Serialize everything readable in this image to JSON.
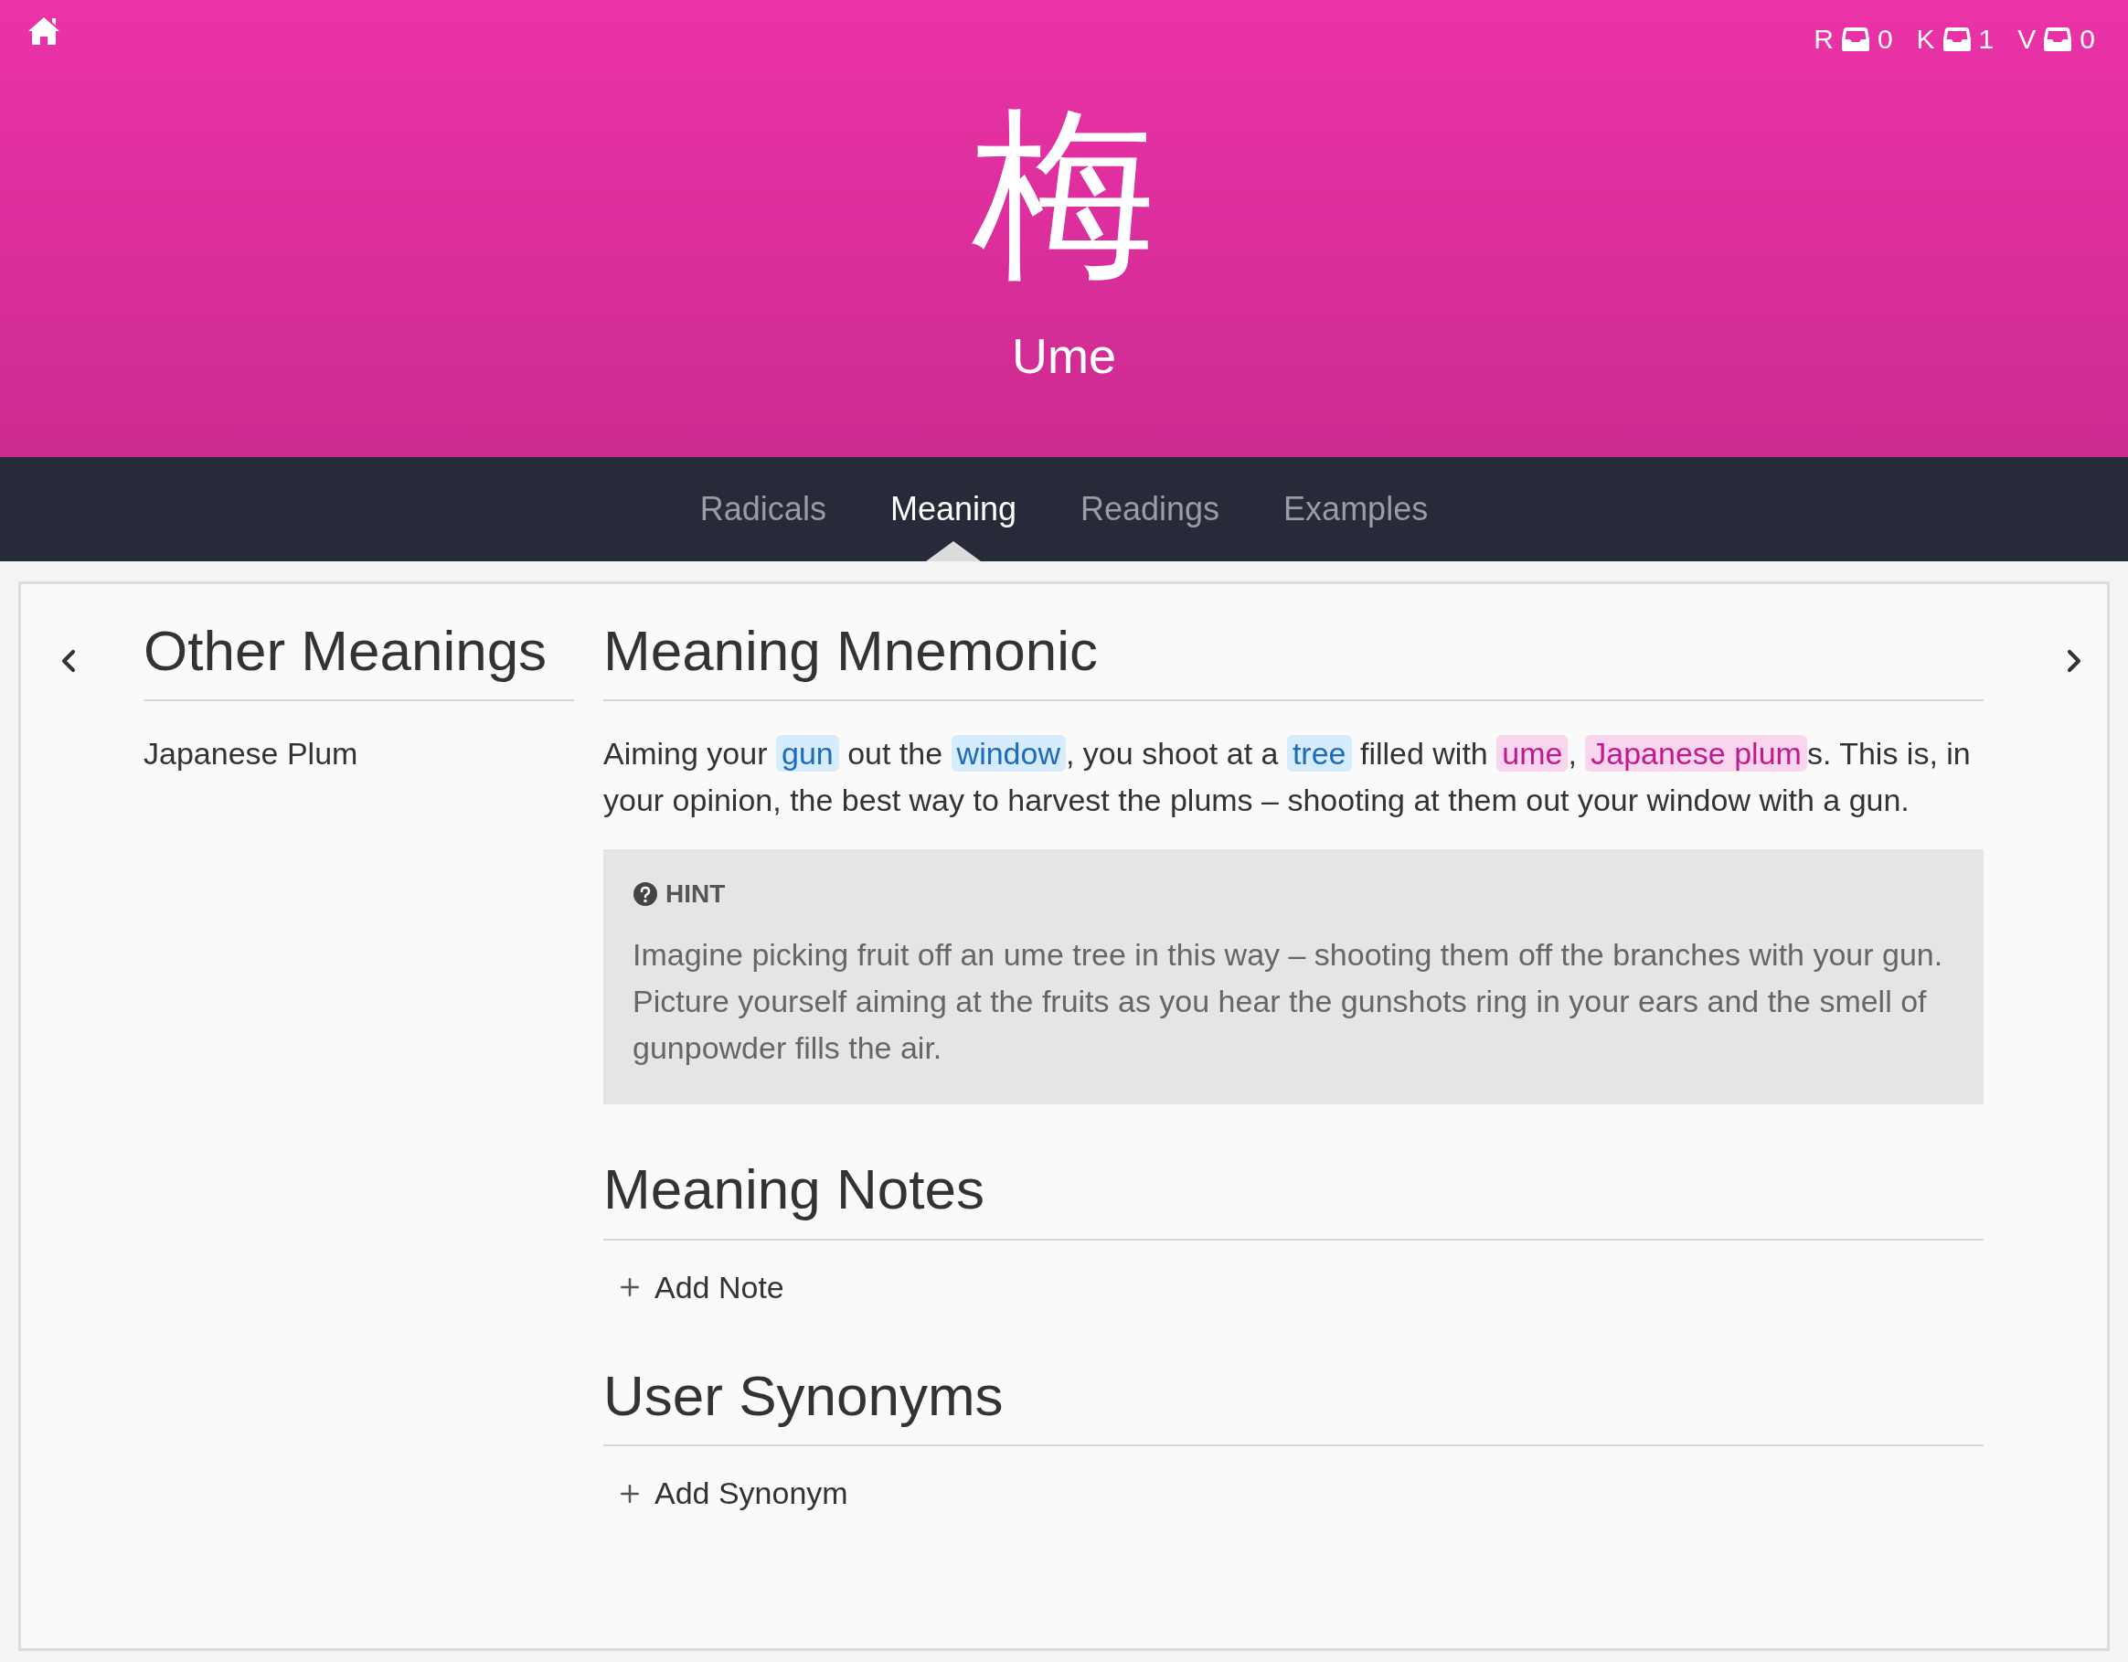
{
  "header": {
    "character": "梅",
    "reading": "Ume",
    "counters": [
      {
        "label": "R",
        "count": "0"
      },
      {
        "label": "K",
        "count": "1"
      },
      {
        "label": "V",
        "count": "0"
      }
    ]
  },
  "tabs": [
    {
      "label": "Radicals",
      "selected": false
    },
    {
      "label": "Meaning",
      "selected": true
    },
    {
      "label": "Readings",
      "selected": false
    },
    {
      "label": "Examples",
      "selected": false
    }
  ],
  "other_meanings": {
    "title": "Other Meanings",
    "items": [
      "Japanese Plum"
    ]
  },
  "mnemonic": {
    "title": "Meaning Mnemonic",
    "segments": [
      {
        "kind": "plain",
        "text": "Aiming your "
      },
      {
        "kind": "radical",
        "text": "gun"
      },
      {
        "kind": "plain",
        "text": " out the "
      },
      {
        "kind": "radical",
        "text": "window"
      },
      {
        "kind": "plain",
        "text": ", you shoot at a "
      },
      {
        "kind": "radical",
        "text": "tree"
      },
      {
        "kind": "plain",
        "text": " filled with "
      },
      {
        "kind": "kanji",
        "text": "ume"
      },
      {
        "kind": "plain",
        "text": ", "
      },
      {
        "kind": "kanji",
        "text": "Japanese plum"
      },
      {
        "kind": "plain",
        "text": "s. This is, in your opinion, the best way to harvest the plums – shooting at them out your window with a gun."
      }
    ]
  },
  "hint": {
    "label": "HINT",
    "text": "Imagine picking fruit off an ume tree in this way – shooting them off the branches with your gun. Picture yourself aiming at the fruits as you hear the gunshots ring in your ears and the smell of gunpowder fills the air."
  },
  "sections": [
    {
      "title": "Meaning Notes",
      "action": "Add Note"
    },
    {
      "title": "User Synonyms",
      "action": "Add Synonym"
    }
  ]
}
